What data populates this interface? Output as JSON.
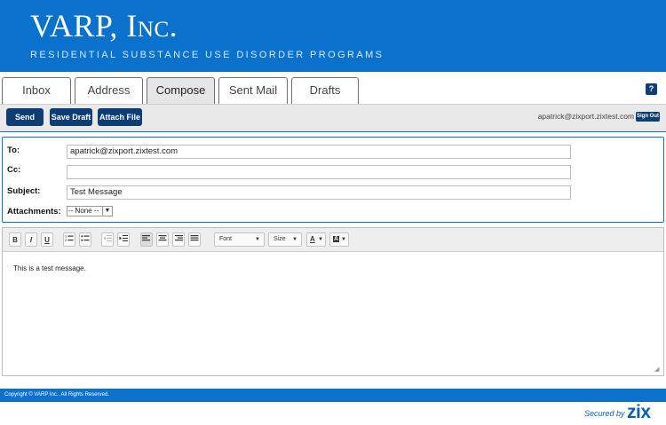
{
  "header": {
    "title": "VARP, Inc.",
    "subtitle": "RESIDENTIAL SUBSTANCE USE DISORDER PROGRAMS"
  },
  "tabs": [
    {
      "label": "Inbox",
      "active": false
    },
    {
      "label": "Address",
      "active": false
    },
    {
      "label": "Compose",
      "active": true
    },
    {
      "label": "Sent Mail",
      "active": false
    },
    {
      "label": "Drafts",
      "active": false
    }
  ],
  "help_label": "?",
  "toolbar": {
    "send": "Send",
    "save_draft": "Save Draft",
    "attach_file": "Attach File",
    "user_email": "apatrick@zixport.zixtest.com",
    "sign_out": "Sign Out"
  },
  "form": {
    "to_label": "To:",
    "to_value": "apatrick@zixport.zixtest.com",
    "cc_label": "Cc:",
    "cc_value": "",
    "subject_label": "Subject:",
    "subject_value": "Test Message",
    "attachments_label": "Attachments:",
    "attachments_selected": "-- None --"
  },
  "editor": {
    "bold": "B",
    "italic": "I",
    "underline": "U",
    "font_label": "Font",
    "size_label": "Size",
    "text_color_label": "A",
    "bg_color_label": "A",
    "body": "This is a test message."
  },
  "icons": [
    "ordered-list-icon",
    "unordered-list-icon",
    "outdent-icon",
    "indent-icon",
    "align-left-icon",
    "align-center-icon",
    "align-right-icon",
    "justify-icon",
    "resize-grip-icon",
    "dropdown-arrow-icon"
  ],
  "footer": {
    "copyright": "Copyright © VARP Inc.. All Rights Reserved.",
    "secured_by": "Secured by",
    "brand": "zix"
  },
  "colors": {
    "brand_blue": "#0a72cc",
    "button_navy": "#0c3e73"
  }
}
